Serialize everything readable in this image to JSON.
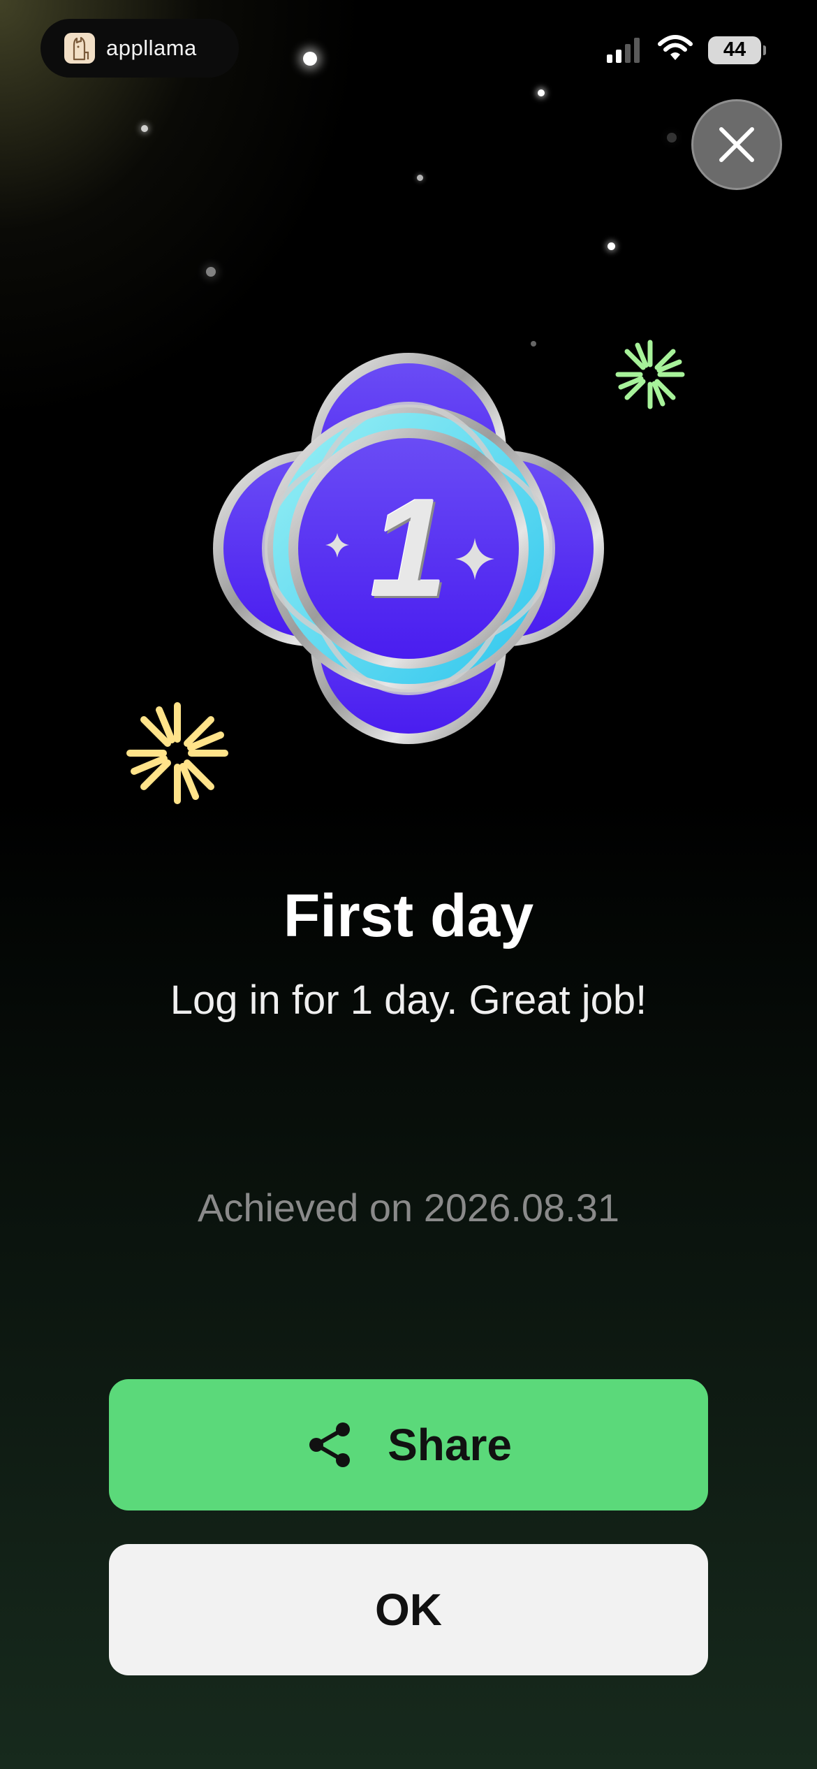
{
  "status_bar": {
    "app_name": "appllama",
    "battery": "44",
    "icons": [
      "llama-logo-icon",
      "cellular-signal-icon",
      "wifi-icon",
      "battery-icon"
    ]
  },
  "close_button": {
    "icon": "close-icon"
  },
  "badge": {
    "number": "1",
    "icon": "first-day-badge-icon"
  },
  "achievement": {
    "title": "First day",
    "description": "Log in for 1 day. Great job!",
    "achieved_on": "Achieved on 2026.08.31"
  },
  "buttons": {
    "share_label": "Share",
    "share_icon": "share-icon",
    "ok_label": "OK"
  },
  "colors": {
    "share_button": "#5bd97a",
    "ok_button": "#f2f2f2",
    "badge_purple": "#5b35f2",
    "badge_cyan": "#5ad8f0",
    "sparkle_green": "#a7f29a",
    "sparkle_yellow": "#ffe38a"
  }
}
